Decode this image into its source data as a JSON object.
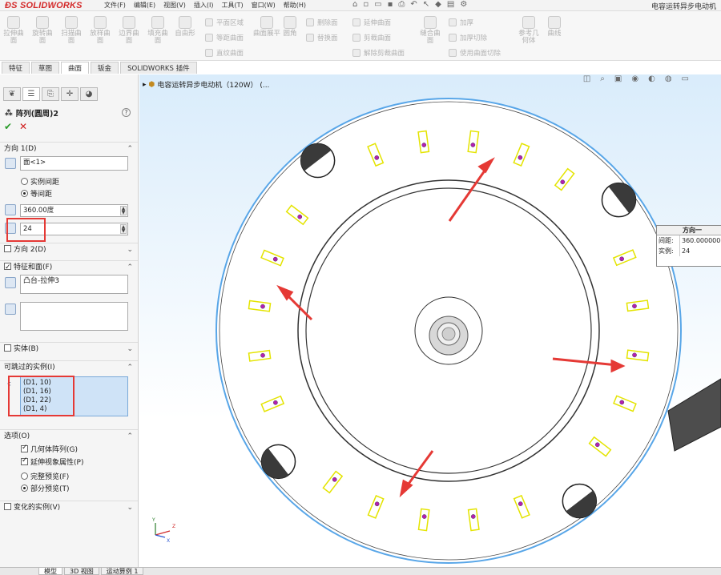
{
  "app": {
    "logo": "SOLIDWORKS",
    "doc_title": "电容运转异步电动机"
  },
  "menus": [
    "文件(F)",
    "编辑(E)",
    "视图(V)",
    "插入(I)",
    "工具(T)",
    "窗口(W)",
    "帮助(H)"
  ],
  "ribbon": {
    "big_buttons": [
      "拉伸曲面",
      "旋转曲面",
      "扫描曲面",
      "放样曲面",
      "边界曲面",
      "填充曲面",
      "自由形"
    ],
    "col1": [
      "平面区域",
      "等距曲面",
      "直纹曲面"
    ],
    "split_btn": "曲面展平",
    "col2": [
      "删除面",
      "替换面"
    ],
    "round_btn": "圆角",
    "col3": [
      "延伸曲面",
      "剪裁曲面",
      "解除剪裁曲面"
    ],
    "knit_btn": "缝合曲面",
    "col4": [
      "加厚",
      "加厚切除",
      "使用曲面切除"
    ],
    "ref_geom": "参考几何体",
    "curves": "曲线"
  },
  "cm_tabs": [
    "特征",
    "草图",
    "曲面",
    "钣金",
    "SOLIDWORKS 插件"
  ],
  "cm_active_tab": "曲面",
  "pm": {
    "title": "阵列(圆周)2",
    "help": "?",
    "ok": "✔",
    "cancel": "✕",
    "dir1": {
      "header": "方向 1(D)",
      "reference": "面<1>",
      "radio1": "实例间距",
      "radio2": "等间距",
      "angle": "360.00度",
      "count": "24"
    },
    "dir2": {
      "header": "方向 2(D)"
    },
    "features": {
      "header": "特征和面(F)",
      "item": "凸台-拉伸3"
    },
    "bodies": {
      "header": "实体(B)"
    },
    "skip": {
      "header": "可跳过的实例(I)",
      "items": [
        "(D1, 10)",
        "(D1, 16)",
        "(D1, 22)",
        "(D1, 4)"
      ]
    },
    "options": {
      "header": "选项(O)",
      "cb1": "几何体阵列(G)",
      "cb2": "延伸视象属性(P)",
      "r1": "完整预览(F)",
      "r2": "部分预览(T)"
    },
    "variable": {
      "header": "变化的实例(V)"
    }
  },
  "viewport": {
    "tree_label": "电容运转异步电动机（120W） (...",
    "callout": {
      "title": "方向一",
      "spacing_label": "间距:",
      "spacing_value": "360.00000000度",
      "count_label": "实例:",
      "count_value": "24"
    },
    "triad": {
      "x": "X",
      "y": "Y",
      "z": "Z"
    }
  },
  "bottom_tabs": [
    "模型",
    "3D 视图",
    "运动算例 1"
  ],
  "bottom_active": "模型",
  "colors": {
    "accent_red": "#e53935",
    "pattern_outline": "#e4e400",
    "hole_dot": "#b21fb2",
    "outer_rim": "#58a6e8"
  }
}
